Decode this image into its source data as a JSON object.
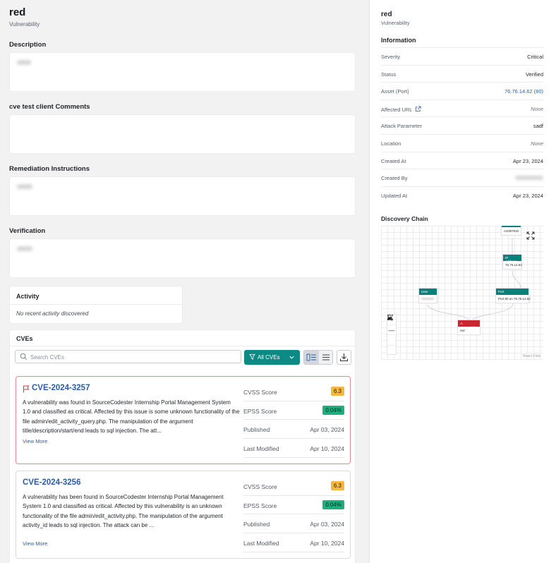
{
  "header": {
    "title": "red",
    "subtitle": "Vulnerability"
  },
  "sections": {
    "description": "Description",
    "comments": "cve test client Comments",
    "remediation": "Remediation Instructions",
    "verification": "Verification"
  },
  "activity": {
    "title": "Activity",
    "empty": "No recent activity discovered"
  },
  "cves": {
    "title": "CVEs",
    "search_placeholder": "Search CVEs",
    "filter_label": "All CVEs",
    "items": [
      {
        "id": "CVE-2024-3257",
        "flagged": true,
        "description": "A vulnerability was found in SourceCodester Internship Portal Management System 1.0 and classified as critical. Affected by this issue is some unknown functionality of the file admin/edit_activity_query.php. The manipulation of the argument title/description/start/end leads to sql injection. The att...",
        "view_more": "View More",
        "cvss_label": "CVSS Score",
        "cvss": "6.3",
        "epss_label": "EPSS Score",
        "epss": "0.04%",
        "published_label": "Published",
        "published": "Apr 03, 2024",
        "modified_label": "Last Modified",
        "modified": "Apr 10, 2024"
      },
      {
        "id": "CVE-2024-3256",
        "flagged": false,
        "description": "A vulnerability has been found in SourceCodester Internship Portal Management System 1.0 and classified as critical. Affected by this vulnerability is an unknown functionality of the file admin/edit_activity.php. The manipulation of the argument activity_id leads to sql injection. The attack can be ...",
        "view_more": "View More",
        "cvss_label": "CVSS Score",
        "cvss": "6.3",
        "epss_label": "EPSS Score",
        "epss": "0.04%",
        "published_label": "Published",
        "published": "Apr 03, 2024",
        "modified_label": "Last Modified",
        "modified": "Apr 10, 2024"
      }
    ]
  },
  "sidebar": {
    "title": "red",
    "subtitle": "Vulnerability",
    "info_title": "Information",
    "rows": [
      {
        "label": "Severity",
        "value": "Critical"
      },
      {
        "label": "Status",
        "value": "Verified"
      },
      {
        "label": "Asset (Port)",
        "value": "76.76.14.62 (80)"
      },
      {
        "label": "Affected URL",
        "value": "None"
      },
      {
        "label": "Attack Parameter",
        "value": "sadf"
      },
      {
        "label": "Location",
        "value": "None"
      },
      {
        "label": "Created At",
        "value": "Apr 23, 2024"
      },
      {
        "label": "Created By",
        "value": ""
      },
      {
        "label": "Updated At",
        "value": "Apr 23, 2024"
      }
    ],
    "chain_title": "Discovery Chain",
    "chain": {
      "asn_value": "AS397919",
      "ip_header": "IP Address",
      "ip_value": "76.76.14.62",
      "user_header": "User",
      "port_header": "Port",
      "port_value": "Port 80 on 76.76.14.62",
      "vuln_header": "Vulnerability",
      "vuln_value": "red",
      "zoom_in": "+",
      "zoom_out": "—",
      "attribution": "React Flow"
    }
  },
  "colors": {
    "accent": "#0c8a83",
    "link": "#2a5da8",
    "cvss_badge": "#f4b740",
    "epss_badge": "#1fae7d",
    "flag": "#e88790"
  }
}
